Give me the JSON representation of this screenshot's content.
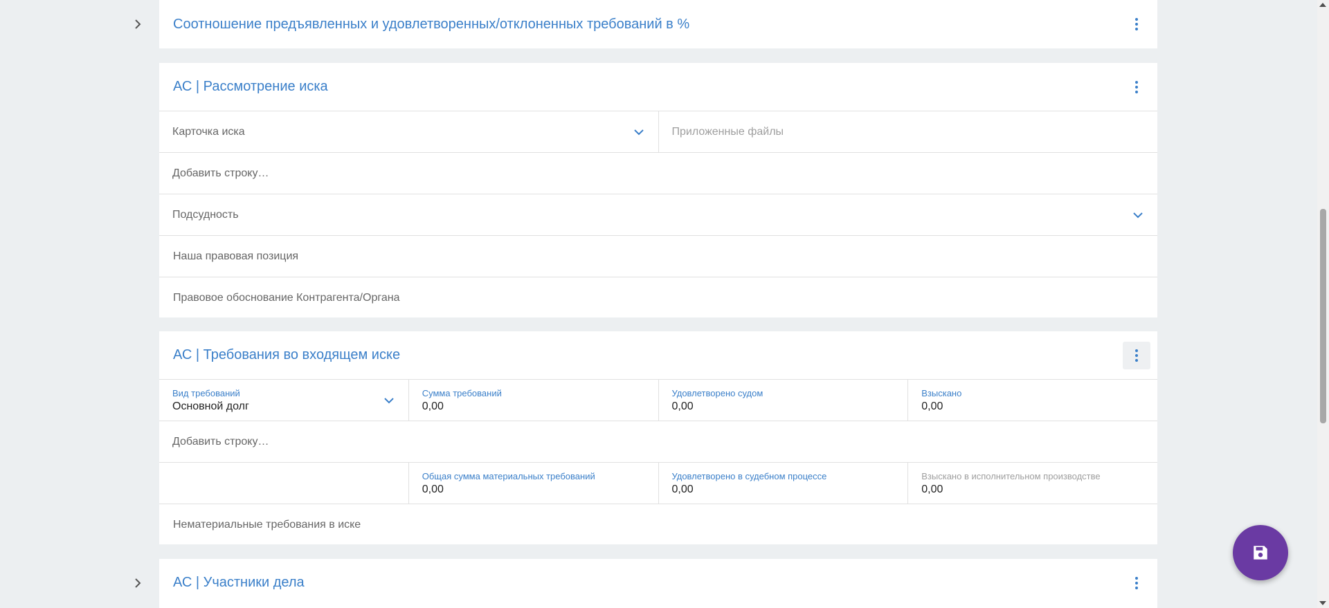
{
  "sections": {
    "ratio": {
      "title": "Соотношение предъявленных и удовлетворенных/отклоненных требований в %"
    },
    "review": {
      "title": "АС | Рассмотрение иска",
      "claim_card": "Карточка иска",
      "attached_files": "Приложенные файлы",
      "add_row": "Добавить строку…",
      "jurisdiction": "Подсудность",
      "our_position": "Наша правовая позиция",
      "counterparty_basis": "Правовое обоснование Контрагента/Органа"
    },
    "claims": {
      "title": "АС | Требования во входящем иске",
      "claim_type_label": "Вид требований",
      "claim_type_value": "Основной долг",
      "claim_sum_label": "Сумма требований",
      "claim_sum_value": "0,00",
      "court_satisfied_label": "Удовлетворено судом",
      "court_satisfied_value": "0,00",
      "recovered_label": "Взыскано",
      "recovered_value": "0,00",
      "add_row": "Добавить строку…",
      "total_material_label": "Общая сумма материальных требований",
      "total_material_value": "0,00",
      "satisfied_process_label": "Удовлетворено в судебном процессе",
      "satisfied_process_value": "0,00",
      "recovered_enforcement_label": "Взыскано в исполнительном производстве",
      "recovered_enforcement_value": "0,00",
      "non_material": "Нематериальные требования в иске"
    },
    "participants": {
      "title": "АС | Участники дела"
    }
  },
  "icons": {
    "expand": "chevron-right-icon",
    "menu": "kebab-menu-icon",
    "dropdown": "chevron-down-icon",
    "save": "save-icon"
  },
  "colors": {
    "accent": "#3a7fc9",
    "fab": "#6a3aa3",
    "background": "#eceff1"
  }
}
